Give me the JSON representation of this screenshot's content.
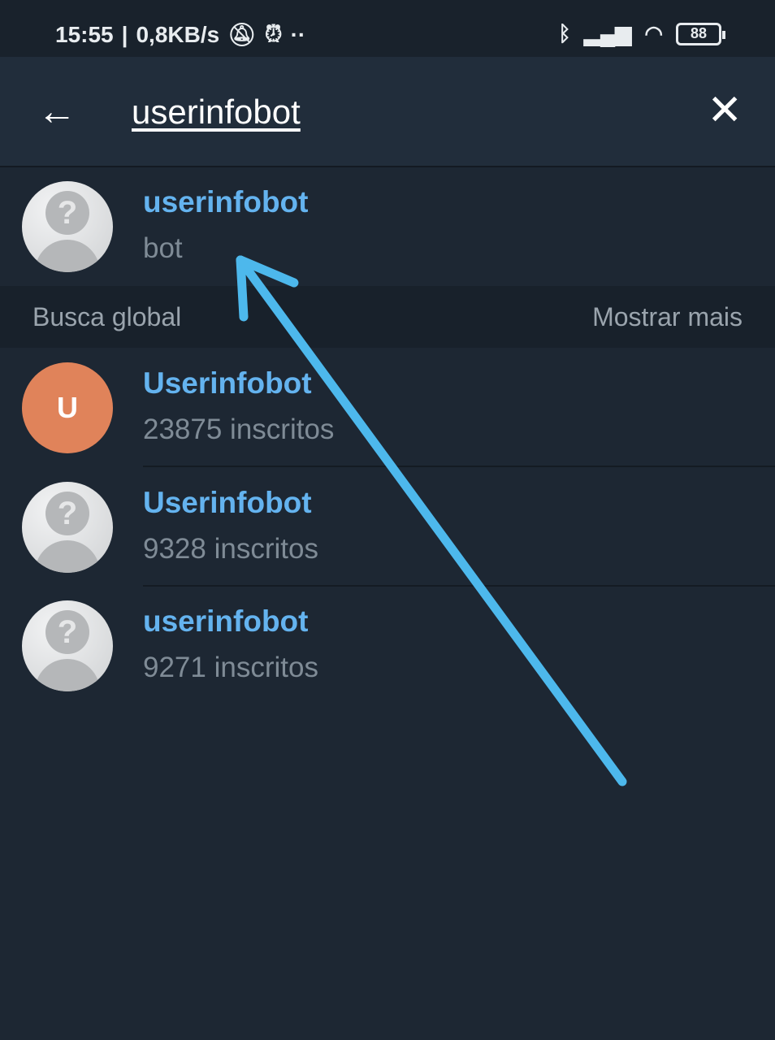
{
  "status_bar": {
    "time": "15:55",
    "net_speed": "0,8KB/s",
    "battery": "88",
    "icons": [
      "mute-bell-icon",
      "alarm-icon",
      "dots-icon",
      "bluetooth-icon",
      "signal-icon",
      "wifi-icon",
      "battery-icon"
    ]
  },
  "search": {
    "query": "userinfobot",
    "back_icon": "arrow-left-icon",
    "clear_icon": "close-icon"
  },
  "local_results": [
    {
      "name": "userinfobot",
      "subtitle": "bot",
      "avatar": "placeholder"
    }
  ],
  "global_section": {
    "title": "Busca global",
    "more_label": "Mostrar mais"
  },
  "global_results": [
    {
      "name": "Userinfobot",
      "subtitle": "23875 inscritos",
      "avatar": "letter",
      "letter": "U",
      "color": "#e0835a"
    },
    {
      "name": "Userinfobot",
      "subtitle": "9328 inscritos",
      "avatar": "placeholder"
    },
    {
      "name": "userinfobot",
      "subtitle": "9271 inscritos",
      "avatar": "placeholder"
    }
  ],
  "annotation": {
    "type": "arrow",
    "color": "#4db8ec"
  },
  "colors": {
    "accent": "#64b3ef",
    "background": "#1d2733",
    "header": "#212d3b"
  }
}
